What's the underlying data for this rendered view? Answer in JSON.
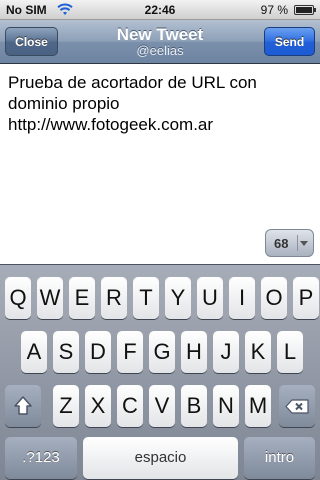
{
  "status_bar": {
    "carrier": "No SIM",
    "time": "22:46",
    "battery_percent": "97 %",
    "battery_level": 0.97
  },
  "nav": {
    "title": "New Tweet",
    "subtitle": "@eelias",
    "close_label": "Close",
    "send_label": "Send"
  },
  "compose": {
    "text": "Prueba de acortador de URL con dominio propio http://www.fotogeek.com.ar",
    "char_count": "68"
  },
  "keyboard": {
    "row1": [
      "Q",
      "W",
      "E",
      "R",
      "T",
      "Y",
      "U",
      "I",
      "O",
      "P"
    ],
    "row2": [
      "A",
      "S",
      "D",
      "F",
      "G",
      "H",
      "J",
      "K",
      "L"
    ],
    "row3": [
      "Z",
      "X",
      "C",
      "V",
      "B",
      "N",
      "M"
    ],
    "numbers_label": ".?123",
    "space_label": "espacio",
    "return_label": "intro"
  },
  "icons": {
    "wifi": "wifi-icon",
    "shift": "shift-icon",
    "backspace": "backspace-icon",
    "dropdown": "chevron-down-icon"
  }
}
